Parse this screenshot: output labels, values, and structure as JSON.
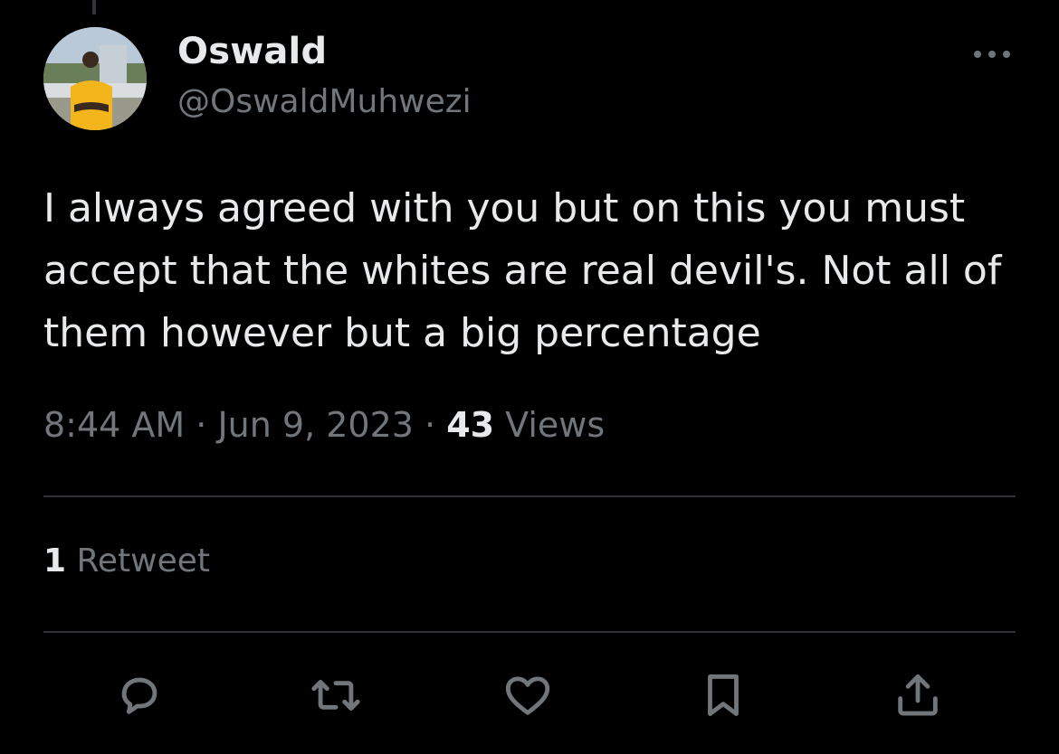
{
  "author": {
    "display_name": "Oswald",
    "handle": "@OswaldMuhwezi",
    "avatar_icon": "avatar-photo"
  },
  "tweet": {
    "text": "I always agreed with you but on this you must accept that the whites are real devil's. Not all of them however but a big percentage"
  },
  "meta": {
    "time": "8:44 AM",
    "separator1": " · ",
    "date": "Jun 9, 2023",
    "separator2": " · ",
    "views_count": "43",
    "views_label": " Views"
  },
  "stats": {
    "retweet_count": "1",
    "retweet_label": " Retweet"
  },
  "actions": [
    {
      "icon": "reply-icon"
    },
    {
      "icon": "retweet-icon"
    },
    {
      "icon": "like-icon"
    },
    {
      "icon": "bookmark-icon"
    },
    {
      "icon": "share-icon"
    }
  ],
  "colors": {
    "background": "#000000",
    "primary_text": "#e7e9ea",
    "secondary_text": "#71767b",
    "divider": "#2f3336"
  }
}
